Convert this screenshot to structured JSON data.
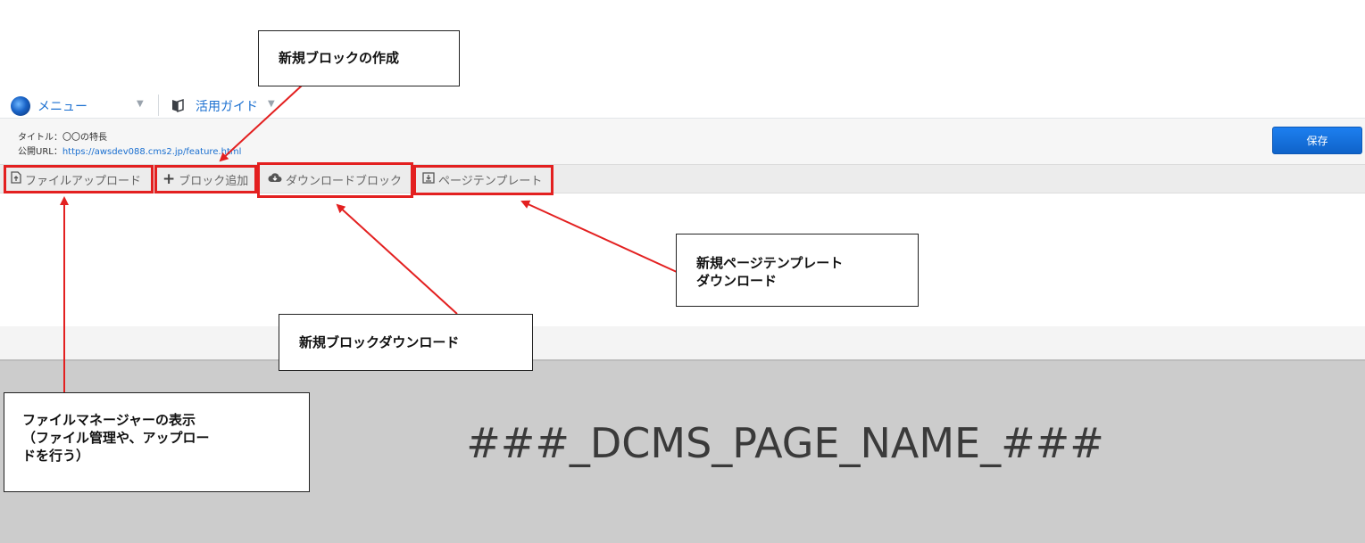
{
  "menubar": {
    "menu_label": "メニュー",
    "guide_label": "活用ガイド",
    "caret": "▼"
  },
  "info": {
    "title_line": "タイトル：〇〇の特長",
    "url_prefix": "公開URL：",
    "url_link": "https://awsdev088.cms2.jp/feature.html"
  },
  "save_label": "保存",
  "toolbar": {
    "file_upload": "ファイルアップロード",
    "add_block": "ブロック追加",
    "download_block": "ダウンロードブロック",
    "page_template": "ページテンプレート"
  },
  "page": {
    "name_placeholder": "###_DCMS_PAGE_NAME_###"
  },
  "annotations": {
    "new_block": "新規ブロックの作成",
    "new_page_template_line1": "新規ページテンプレート",
    "new_page_template_line2": "ダウンロード",
    "new_block_download": "新規ブロックダウンロード",
    "file_manager_line1": "ファイルマネージャーの表示",
    "file_manager_line2": "（ファイル管理や、アップロー",
    "file_manager_line3": "ドを行う）"
  },
  "colors": {
    "accent": "#1a6fd0",
    "save_button": "#1a75e0",
    "highlight": "#e32020",
    "hero_bg": "#cccccc"
  }
}
